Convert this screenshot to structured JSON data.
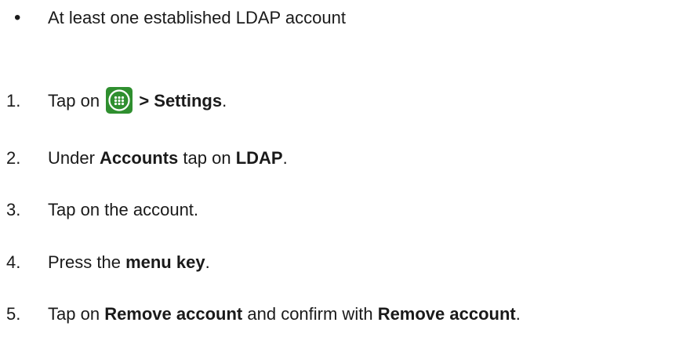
{
  "requirements": {
    "bullet": "•",
    "item": "At least one established LDAP account"
  },
  "steps": [
    {
      "number": "1.",
      "parts": [
        "Tap on",
        "> Settings",
        "."
      ]
    },
    {
      "number": "2.",
      "parts": [
        "Under",
        "Accounts",
        "tap on",
        "LDAP",
        "."
      ]
    },
    {
      "number": "3.",
      "parts": [
        "Tap on the account."
      ]
    },
    {
      "number": "4.",
      "parts": [
        "Press the",
        "menu key",
        "."
      ]
    },
    {
      "number": "5.",
      "parts": [
        "Tap on",
        "Remove account",
        "and confirm with",
        "Remove account",
        "."
      ]
    }
  ],
  "icons": {
    "apps": "apps-grid-icon",
    "apps_bg": "#2f8f2f",
    "apps_fg": "#ffffff"
  }
}
